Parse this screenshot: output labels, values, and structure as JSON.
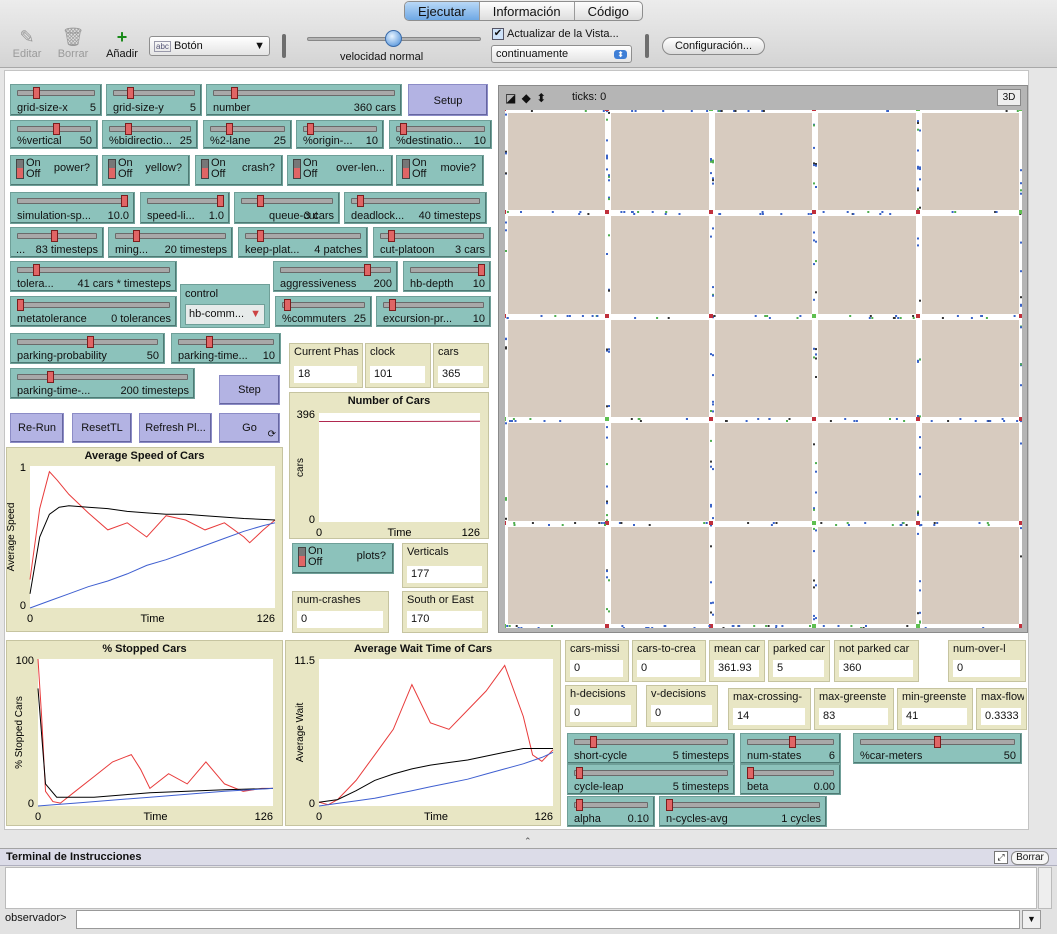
{
  "tabs": [
    "Ejecutar",
    "Información",
    "Código"
  ],
  "toolbar": {
    "edit": "Editar",
    "delete": "Borrar",
    "add": "Añadir",
    "widget_type": "Botón",
    "speed_label": "velocidad normal",
    "update_view": "Actualizar de la Vista...",
    "update_mode": "continuamente",
    "settings": "Configuración..."
  },
  "sliders": {
    "grid_x": {
      "label": "grid-size-x",
      "value": "5"
    },
    "grid_y": {
      "label": "grid-size-y",
      "value": "5"
    },
    "number": {
      "label": "number",
      "value": "360 cars"
    },
    "vertical": {
      "label": "%vertical",
      "value": "50"
    },
    "bidir": {
      "label": "%bidirectio...",
      "value": "25"
    },
    "two_lane": {
      "label": "%2-lane",
      "value": "25"
    },
    "origin": {
      "label": "%origin-...",
      "value": "10"
    },
    "destination": {
      "label": "%destinatio...",
      "value": "10"
    },
    "sim_speed": {
      "label": "simulation-sp...",
      "value": "10.0"
    },
    "speed_limit": {
      "label": "speed-li...",
      "value": "1.0"
    },
    "queue_cut": {
      "label": "queue-cut",
      "value": "3 cars"
    },
    "deadlock": {
      "label": "deadlock...",
      "value": "40 timesteps"
    },
    "ts83": {
      "label": "...",
      "value": "83 timesteps"
    },
    "ming": {
      "label": "ming...",
      "value": "20 timesteps"
    },
    "keep_plat": {
      "label": "keep-plat...",
      "value": "4 patches"
    },
    "cut_platoon": {
      "label": "cut-platoon",
      "value": "3 cars"
    },
    "tolerance": {
      "label": "tolera...",
      "value": "41 cars * timesteps"
    },
    "aggressiveness": {
      "label": "aggressiveness",
      "value": "200"
    },
    "hb_depth": {
      "label": "hb-depth",
      "value": "10"
    },
    "metatolerance": {
      "label": "metatolerance",
      "value": "0 tolerances"
    },
    "commuters": {
      "label": "%commuters",
      "value": "25"
    },
    "excursion": {
      "label": "excursion-pr...",
      "value": "10"
    },
    "parking_prob": {
      "label": "parking-probability",
      "value": "50"
    },
    "parking_time1": {
      "label": "parking-time...",
      "value": "10"
    },
    "parking_time2": {
      "label": "parking-time-...",
      "value": "200 timesteps"
    },
    "short_cycle": {
      "label": "short-cycle",
      "value": "5 timesteps"
    },
    "num_states": {
      "label": "num-states",
      "value": "6"
    },
    "car_meters": {
      "label": "%car-meters",
      "value": "50"
    },
    "cycle_leap": {
      "label": "cycle-leap",
      "value": "5 timesteps"
    },
    "beta": {
      "label": "beta",
      "value": "0.00"
    },
    "alpha": {
      "label": "alpha",
      "value": "0.10"
    },
    "n_cycles": {
      "label": "n-cycles-avg",
      "value": "1 cycles"
    }
  },
  "toggles": {
    "power": "power?",
    "yellow": "yellow?",
    "crash": "crash?",
    "over_len": "over-len...",
    "movie": "movie?",
    "plots": "plots?",
    "on": "On",
    "off": "Off"
  },
  "buttons": {
    "setup": "Setup",
    "step": "Step",
    "rerun": "Re-Run",
    "resettl": "ResetTL",
    "refresh": "Refresh Pl...",
    "go": "Go"
  },
  "chooser": {
    "label": "control",
    "value": "hb-comm..."
  },
  "monitors": {
    "phase": {
      "label": "Current Phas",
      "value": "18"
    },
    "clock": {
      "label": "clock",
      "value": "101"
    },
    "cars": {
      "label": "cars",
      "value": "365"
    },
    "verticals": {
      "label": "Verticals",
      "value": "177"
    },
    "num_crashes": {
      "label": "num-crashes",
      "value": "0"
    },
    "south_east": {
      "label": "South or East",
      "value": "170"
    },
    "cars_missing": {
      "label": "cars-missi",
      "value": "0"
    },
    "cars_to_create": {
      "label": "cars-to-crea",
      "value": "0"
    },
    "mean_car": {
      "label": "mean car",
      "value": "361.93"
    },
    "parked_car": {
      "label": "parked car",
      "value": "5"
    },
    "not_parked": {
      "label": "not parked car",
      "value": "360"
    },
    "num_over": {
      "label": "num-over-l",
      "value": "0"
    },
    "h_decisions": {
      "label": "h-decisions",
      "value": "0"
    },
    "v_decisions": {
      "label": "v-decisions",
      "value": "0"
    },
    "max_crossing": {
      "label": "max-crossing-",
      "value": "14"
    },
    "max_green": {
      "label": "max-greenste",
      "value": "83"
    },
    "min_green": {
      "label": "min-greenste",
      "value": "41"
    },
    "max_flow": {
      "label": "max-flow",
      "value": "0.3333"
    }
  },
  "view": {
    "ticks": "ticks: 0",
    "three_d": "3D"
  },
  "terminal": {
    "title": "Terminal de Instrucciones",
    "clear": "Borrar",
    "observer": "observador>"
  },
  "chart_data": [
    {
      "type": "line",
      "title": "Number of Cars",
      "ylabel": "cars",
      "xlabel": "Time",
      "xlim": [
        0,
        126
      ],
      "ylim": [
        0,
        396
      ],
      "y_ticks": [
        "396",
        "0"
      ],
      "x_ticks": [
        "0",
        "126"
      ],
      "series": [
        {
          "color": "#b0284f",
          "x": [
            0,
            60,
            126
          ],
          "y": [
            365,
            365,
            366
          ]
        }
      ]
    },
    {
      "type": "line",
      "title": "Average Speed of Cars",
      "ylabel": "Average Speed",
      "xlabel": "Time",
      "xlim": [
        0,
        126
      ],
      "ylim": [
        0,
        1
      ],
      "y_ticks": [
        "1",
        "0"
      ],
      "x_ticks": [
        "0",
        "126"
      ],
      "series": [
        {
          "color": "#e83b3b",
          "x": [
            0,
            5,
            10,
            14,
            20,
            30,
            40,
            50,
            60,
            70,
            80,
            90,
            100,
            110,
            113,
            120,
            126
          ],
          "y": [
            0.2,
            0.7,
            0.96,
            0.9,
            0.8,
            0.67,
            0.55,
            0.6,
            0.5,
            0.65,
            0.62,
            0.55,
            0.6,
            0.5,
            0.46,
            0.55,
            0.62
          ]
        },
        {
          "color": "#000000",
          "x": [
            0,
            5,
            10,
            15,
            20,
            30,
            40,
            50,
            60,
            70,
            80,
            90,
            100,
            110,
            126
          ],
          "y": [
            0.1,
            0.5,
            0.66,
            0.71,
            0.72,
            0.71,
            0.7,
            0.68,
            0.67,
            0.66,
            0.66,
            0.65,
            0.64,
            0.63,
            0.62
          ]
        },
        {
          "color": "#3f5fd0",
          "x": [
            0,
            10,
            20,
            30,
            40,
            50,
            60,
            70,
            80,
            90,
            100,
            110,
            120,
            126
          ],
          "y": [
            0.0,
            0.05,
            0.1,
            0.15,
            0.19,
            0.24,
            0.3,
            0.34,
            0.39,
            0.44,
            0.49,
            0.54,
            0.58,
            0.6
          ]
        }
      ]
    },
    {
      "type": "line",
      "title": "% Stopped Cars",
      "ylabel": "% Stopped Cars",
      "xlabel": "Time",
      "xlim": [
        0,
        126
      ],
      "ylim": [
        0,
        100
      ],
      "y_ticks": [
        "100",
        "0"
      ],
      "x_ticks": [
        "0",
        "126"
      ],
      "series": [
        {
          "color": "#e83b3b",
          "x": [
            0,
            2,
            4,
            8,
            12,
            20,
            30,
            40,
            50,
            55,
            60,
            70,
            80,
            90,
            100,
            110,
            120,
            126
          ],
          "y": [
            100,
            60,
            10,
            3,
            2,
            10,
            20,
            30,
            35,
            25,
            12,
            22,
            15,
            30,
            15,
            10,
            12,
            12
          ]
        },
        {
          "color": "#000000",
          "x": [
            0,
            4,
            10,
            20,
            30,
            40,
            50,
            60,
            80,
            100,
            126
          ],
          "y": [
            80,
            15,
            6,
            6,
            6,
            7,
            8,
            9,
            10,
            11,
            12
          ]
        },
        {
          "color": "#3f5fd0",
          "x": [
            0,
            10,
            20,
            30,
            40,
            60,
            80,
            100,
            126
          ],
          "y": [
            0,
            1,
            2,
            3,
            4,
            6,
            8,
            10,
            12
          ]
        }
      ]
    },
    {
      "type": "line",
      "title": "Average Wait Time of Cars",
      "ylabel": "Average Wait",
      "xlabel": "Time",
      "xlim": [
        0,
        126
      ],
      "ylim": [
        0,
        11.5
      ],
      "y_ticks": [
        "11.5",
        "0"
      ],
      "x_ticks": [
        "0",
        "126"
      ],
      "series": [
        {
          "color": "#e83b3b",
          "x": [
            0,
            5,
            10,
            20,
            30,
            40,
            50,
            60,
            70,
            80,
            90,
            100,
            110,
            115,
            120,
            126
          ],
          "y": [
            0.3,
            0.1,
            0.5,
            2,
            4,
            6,
            9.5,
            6.5,
            6,
            7.5,
            9,
            11,
            7,
            4,
            3.5,
            4.4
          ]
        },
        {
          "color": "#000000",
          "x": [
            0,
            10,
            20,
            30,
            40,
            50,
            60,
            70,
            80,
            90,
            100,
            110,
            120,
            126
          ],
          "y": [
            0.3,
            0.5,
            1.2,
            2,
            2.5,
            2.9,
            3.2,
            3.4,
            3.6,
            3.9,
            4.2,
            4.5,
            4.5,
            4.5
          ]
        },
        {
          "color": "#3f5fd0",
          "x": [
            0,
            10,
            20,
            30,
            40,
            50,
            60,
            70,
            80,
            90,
            100,
            110,
            120,
            126
          ],
          "y": [
            0,
            0.2,
            0.4,
            0.6,
            0.9,
            1.2,
            1.5,
            1.8,
            2.1,
            2.5,
            2.9,
            3.3,
            3.8,
            4.2
          ]
        }
      ]
    }
  ]
}
